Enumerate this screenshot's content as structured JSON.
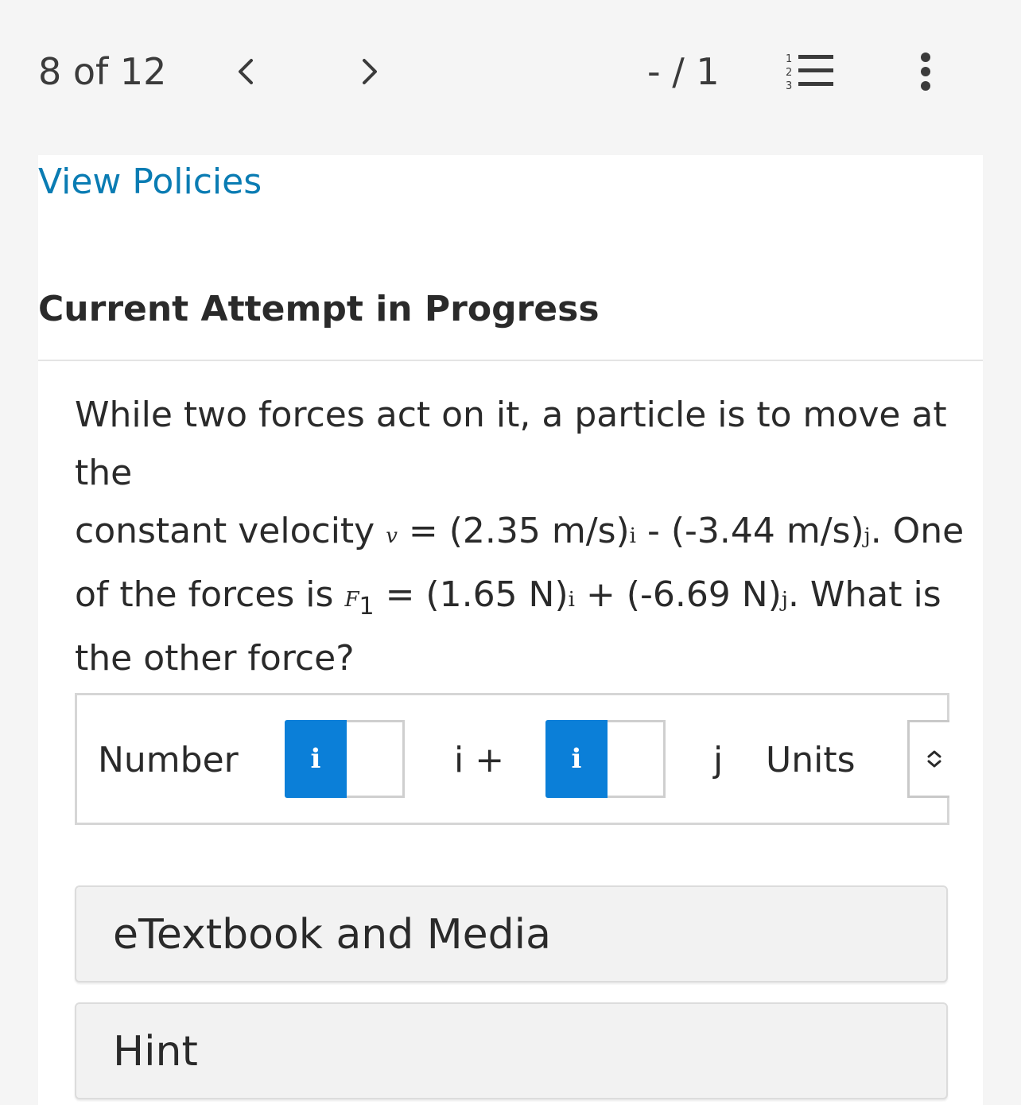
{
  "topbar": {
    "counter": "8 of 12",
    "prev_icon": "chevron-left-icon",
    "next_icon": "chevron-right-icon",
    "score": "- / 1",
    "list_icon": "numbered-list-icon",
    "more_icon": "vertical-ellipsis-icon"
  },
  "policies": {
    "link_label": "View Policies"
  },
  "attempt": {
    "header": "Current Attempt in Progress"
  },
  "question": {
    "line1": "While two forces act on it, a particle is to move at the",
    "seg_a": "constant velocity ",
    "v_symbol": "v",
    "seg_b": " = (2.35 m/s)",
    "i_hat_1": "i",
    "seg_c": " - (-3.44 m/s)",
    "j_hat_1": "j",
    "seg_d": ". One",
    "seg_e": "of the forces is ",
    "f_symbol": "F",
    "f_sub": "1",
    "seg_f": " = (1.65 N)",
    "i_hat_2": "i",
    "seg_g": " + (-6.69 N)",
    "j_hat_2": "j",
    "seg_h": ". What is",
    "line4": "the other force?"
  },
  "answer": {
    "label": "Number",
    "info_label_1": "i",
    "input_1_value": "",
    "i_plus": "i +",
    "info_label_2": "i",
    "input_2_value": "",
    "j_label": "j",
    "units_label": "Units",
    "units_icon": "up-down-chevron-icon"
  },
  "sections": {
    "etextbook": "eTextbook and Media",
    "hint": "Hint"
  },
  "colors": {
    "link": "#0a7cb3",
    "info_button": "#0b7fd8",
    "panel_bg": "#ffffff",
    "page_bg": "#f5f5f5"
  }
}
